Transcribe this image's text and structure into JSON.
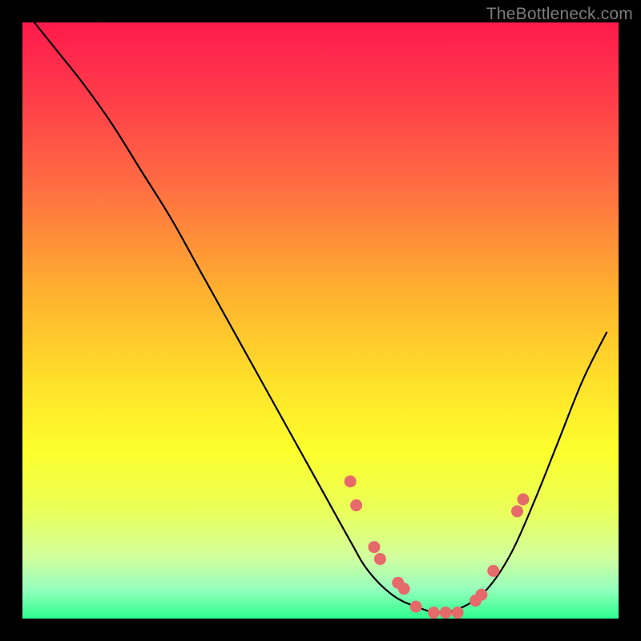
{
  "watermark": "TheBottleneck.com",
  "chart_data": {
    "type": "line",
    "title": "",
    "xlabel": "",
    "ylabel": "",
    "xlim": [
      0,
      100
    ],
    "ylim": [
      0,
      100
    ],
    "series": [
      {
        "name": "bottleneck-curve",
        "x": [
          2,
          6,
          10,
          15,
          20,
          25,
          30,
          35,
          40,
          45,
          50,
          55,
          58,
          62,
          66,
          70,
          74,
          78,
          82,
          86,
          90,
          94,
          98
        ],
        "y": [
          100,
          95,
          90,
          83,
          75,
          67,
          58,
          49,
          40,
          31,
          22,
          13,
          8,
          4,
          2,
          1,
          2,
          5,
          11,
          20,
          30,
          40,
          48
        ]
      }
    ],
    "markers": {
      "name": "highlight-dots",
      "color": "#e66a6a",
      "points": [
        {
          "x": 55,
          "y": 23
        },
        {
          "x": 56,
          "y": 19
        },
        {
          "x": 59,
          "y": 12
        },
        {
          "x": 60,
          "y": 10
        },
        {
          "x": 63,
          "y": 6
        },
        {
          "x": 64,
          "y": 5
        },
        {
          "x": 66,
          "y": 2
        },
        {
          "x": 69,
          "y": 1
        },
        {
          "x": 71,
          "y": 1
        },
        {
          "x": 73,
          "y": 1
        },
        {
          "x": 76,
          "y": 3
        },
        {
          "x": 77,
          "y": 4
        },
        {
          "x": 79,
          "y": 8
        },
        {
          "x": 83,
          "y": 18
        },
        {
          "x": 84,
          "y": 20
        }
      ]
    },
    "background_gradient": {
      "top": "#ff1a4d",
      "mid": "#ffe02a",
      "bottom": "#2dff8f"
    }
  }
}
